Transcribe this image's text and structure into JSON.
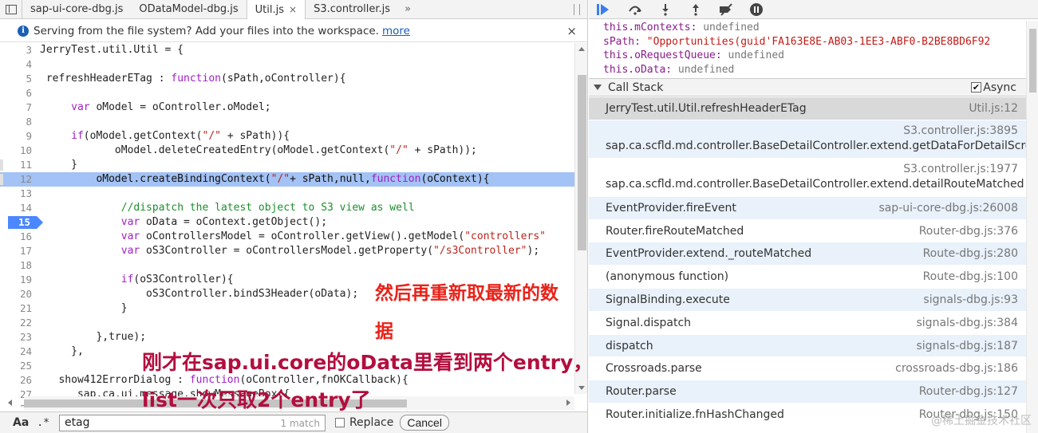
{
  "tabs": [
    {
      "label": "sap-ui-core-dbg.js",
      "active": false
    },
    {
      "label": "ODataModel-dbg.js",
      "active": false
    },
    {
      "label": "Util.js",
      "active": true
    },
    {
      "label": "S3.controller.js",
      "active": false
    }
  ],
  "tab_close_symbol": "×",
  "tab_more_symbol": "»",
  "infobar": {
    "message": "Serving from the file system? Add your files into the workspace.",
    "link": "more",
    "close_symbol": "×",
    "icon": "i"
  },
  "editor": {
    "breakpoint_line": "15",
    "lines": [
      {
        "n": "3",
        "text": "JerryTest.util.Util = {"
      },
      {
        "n": "4",
        "text": ""
      },
      {
        "n": "5",
        "text": " refreshHeaderETag : function(sPath,oController){"
      },
      {
        "n": "6",
        "text": ""
      },
      {
        "n": "7",
        "text": "     var oModel = oController.oModel;"
      },
      {
        "n": "8",
        "text": ""
      },
      {
        "n": "9",
        "text": "     if(oModel.getContext(\"/\" + sPath)){"
      },
      {
        "n": "10",
        "text": "            oModel.deleteCreatedEntry(oModel.getContext(\"/\" + sPath));"
      },
      {
        "n": "11",
        "text": "     }"
      },
      {
        "n": "12",
        "text": "         oModel.createBindingContext(\"/\"+ sPath,null,function(oContext){"
      },
      {
        "n": "13",
        "text": ""
      },
      {
        "n": "14",
        "text": "             //dispatch the latest object to S3 view as well"
      },
      {
        "n": "15",
        "text": "             var oData = oContext.getObject();"
      },
      {
        "n": "16",
        "text": "             var oControllersModel = oController.getView().getModel(\"controllers\""
      },
      {
        "n": "17",
        "text": "             var oS3Controller = oControllersModel.getProperty(\"/s3Controller\");"
      },
      {
        "n": "18",
        "text": ""
      },
      {
        "n": "19",
        "text": "             if(oS3Controller){"
      },
      {
        "n": "20",
        "text": "                 oS3Controller.bindS3Header(oData);"
      },
      {
        "n": "21",
        "text": "             }"
      },
      {
        "n": "22",
        "text": ""
      },
      {
        "n": "23",
        "text": "         },true);"
      },
      {
        "n": "24",
        "text": "     },"
      },
      {
        "n": "25",
        "text": ""
      },
      {
        "n": "26",
        "text": "   show412ErrorDialog : function(oController,fnOKCallback){"
      },
      {
        "n": "27",
        "text": "      sap.ca.ui.message.showMessageBox({"
      },
      {
        "n": "28",
        "text": ""
      }
    ]
  },
  "search": {
    "case_label": "Aa",
    "regex_label": ".*",
    "query": "etag",
    "match_count": "1 match",
    "replace_label": "Replace",
    "cancel_label": "Cancel"
  },
  "annotations": {
    "line1": "然后再重新取最新的数",
    "line2": "据",
    "line3": "刚才在sap.ui.core的oData里看到两个entry，是因为我现在hard code",
    "line4": "list一次只取2个entry了"
  },
  "scope": [
    {
      "key": "this.mContexts",
      "value": "undefined",
      "string": false
    },
    {
      "key": "sPath",
      "value": "\"Opportunities(guid'FA163E8E-AB03-1EE3-ABF0-B2BE8BD6F92",
      "string": true
    },
    {
      "key": "this.oRequestQueue",
      "value": "undefined",
      "string": false
    },
    {
      "key": "this.oData",
      "value": "undefined",
      "string": false
    }
  ],
  "callstack": {
    "title": "Call Stack",
    "async_label": "Async",
    "async_checked": "✔",
    "frames": [
      {
        "name": "JerryTest.util.Util.refreshHeaderETag",
        "location": "Util.js:12"
      },
      {
        "name": "sap.ca.scfld.md.controller.BaseDetailController.extend.getDataForDetailScreen",
        "location": "S3.controller.js:3895"
      },
      {
        "name": "sap.ca.scfld.md.controller.BaseDetailController.extend.detailRouteMatched",
        "location": "S3.controller.js:1977"
      },
      {
        "name": "EventProvider.fireEvent",
        "location": "sap-ui-core-dbg.js:26008"
      },
      {
        "name": "Router.fireRouteMatched",
        "location": "Router-dbg.js:376"
      },
      {
        "name": "EventProvider.extend._routeMatched",
        "location": "Route-dbg.js:280"
      },
      {
        "name": "(anonymous function)",
        "location": "Route-dbg.js:100"
      },
      {
        "name": "SignalBinding.execute",
        "location": "signals-dbg.js:93"
      },
      {
        "name": "Signal.dispatch",
        "location": "signals-dbg.js:384"
      },
      {
        "name": "dispatch",
        "location": "signals-dbg.js:187"
      },
      {
        "name": "Crossroads.parse",
        "location": "crossroads-dbg.js:186"
      },
      {
        "name": "Router.parse",
        "location": "Router-dbg.js:127"
      },
      {
        "name": "Router.initialize.fnHashChanged",
        "location": "Router-dbg.js:150"
      }
    ]
  },
  "watermark": "@稀土掘金技术社区"
}
